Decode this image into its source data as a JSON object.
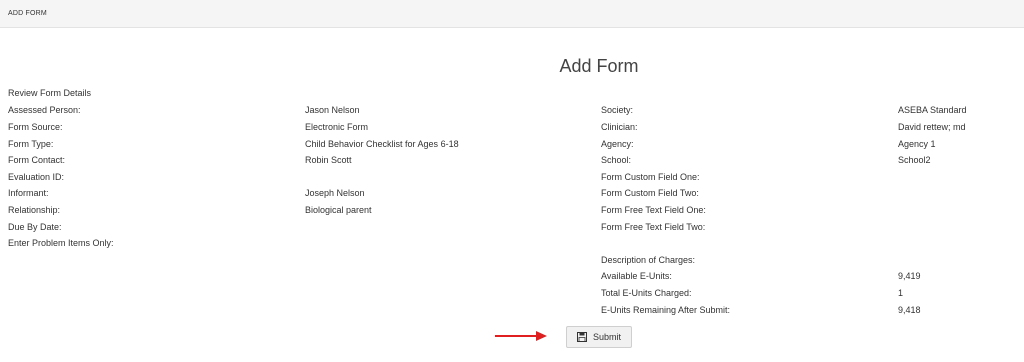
{
  "header": {
    "title": "ADD FORM"
  },
  "page": {
    "title": "Add Form",
    "section_title": "Review Form Details"
  },
  "left_fields": [
    {
      "label": "Assessed Person:",
      "value": "Jason Nelson"
    },
    {
      "label": "Form Source:",
      "value": "Electronic Form"
    },
    {
      "label": "Form Type:",
      "value": "Child Behavior Checklist for Ages 6-18"
    },
    {
      "label": "Form Contact:",
      "value": "Robin Scott"
    },
    {
      "label": "Evaluation ID:",
      "value": ""
    },
    {
      "label": "Informant:",
      "value": "Joseph Nelson"
    },
    {
      "label": "Relationship:",
      "value": "Biological parent"
    },
    {
      "label": "Due By Date:",
      "value": ""
    },
    {
      "label": "Enter Problem Items Only:",
      "value": ""
    }
  ],
  "right_fields": [
    {
      "label": "Society:",
      "value": "ASEBA Standard"
    },
    {
      "label": "Clinician:",
      "value": "David rettew; md"
    },
    {
      "label": "Agency:",
      "value": "Agency 1"
    },
    {
      "label": "School:",
      "value": "School2"
    },
    {
      "label": "Form Custom Field One:",
      "value": ""
    },
    {
      "label": "Form Custom Field Two:",
      "value": ""
    },
    {
      "label": "Form Free Text Field One:",
      "value": ""
    },
    {
      "label": "Form Free Text Field Two:",
      "value": ""
    }
  ],
  "charges": {
    "title": "Description of Charges:",
    "items": [
      {
        "label": "Available E-Units:",
        "value": "9,419"
      },
      {
        "label": "Total E-Units Charged:",
        "value": "1"
      },
      {
        "label": "E-Units Remaining After Submit:",
        "value": "9,418"
      }
    ]
  },
  "submit": {
    "label": "Submit",
    "icon": "save-icon"
  },
  "colors": {
    "arrow": "#e02020"
  }
}
